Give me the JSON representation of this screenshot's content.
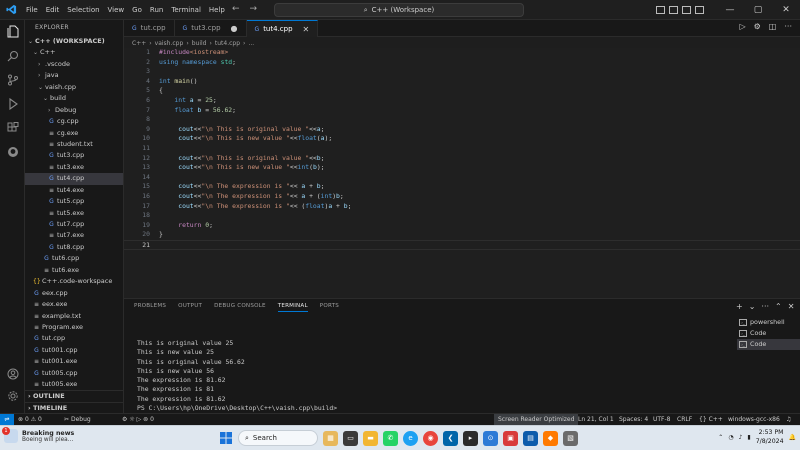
{
  "menu": [
    "File",
    "Edit",
    "Selection",
    "View",
    "Go",
    "Run",
    "Terminal",
    "Help"
  ],
  "command_center": "C++ (Workspace)",
  "sidebar": {
    "title": "EXPLORER",
    "tree": [
      {
        "label": "C++ (WORKSPACE)",
        "depth": 0,
        "kind": "folder-open",
        "bold": true
      },
      {
        "label": "C++",
        "depth": 1,
        "kind": "folder-open"
      },
      {
        "label": ".vscode",
        "depth": 2,
        "kind": "folder"
      },
      {
        "label": "java",
        "depth": 2,
        "kind": "folder"
      },
      {
        "label": "vaish.cpp",
        "depth": 2,
        "kind": "folder-open"
      },
      {
        "label": "build",
        "depth": 3,
        "kind": "folder-open"
      },
      {
        "label": "Debug",
        "depth": 4,
        "kind": "folder"
      },
      {
        "label": "cg.cpp",
        "depth": 4,
        "kind": "cpp"
      },
      {
        "label": "cg.exe",
        "depth": 4,
        "kind": "exe"
      },
      {
        "label": "student.txt",
        "depth": 4,
        "kind": "txt"
      },
      {
        "label": "tut3.cpp",
        "depth": 4,
        "kind": "cpp"
      },
      {
        "label": "tut3.exe",
        "depth": 4,
        "kind": "exe"
      },
      {
        "label": "tut4.cpp",
        "depth": 4,
        "kind": "cpp",
        "active": true
      },
      {
        "label": "tut4.exe",
        "depth": 4,
        "kind": "exe"
      },
      {
        "label": "tut5.cpp",
        "depth": 4,
        "kind": "cpp"
      },
      {
        "label": "tut5.exe",
        "depth": 4,
        "kind": "exe"
      },
      {
        "label": "tut7.cpp",
        "depth": 4,
        "kind": "cpp"
      },
      {
        "label": "tut7.exe",
        "depth": 4,
        "kind": "exe"
      },
      {
        "label": "tut8.cpp",
        "depth": 4,
        "kind": "cpp"
      },
      {
        "label": "tut6.cpp",
        "depth": 3,
        "kind": "cpp"
      },
      {
        "label": "tut6.exe",
        "depth": 3,
        "kind": "exe"
      },
      {
        "label": "C++.code-workspace",
        "depth": 1,
        "kind": "ws"
      },
      {
        "label": "eex.cpp",
        "depth": 1,
        "kind": "cpp"
      },
      {
        "label": "eex.exe",
        "depth": 1,
        "kind": "exe"
      },
      {
        "label": "example.txt",
        "depth": 1,
        "kind": "txt"
      },
      {
        "label": "Program.exe",
        "depth": 1,
        "kind": "exe"
      },
      {
        "label": "tut.cpp",
        "depth": 1,
        "kind": "cpp"
      },
      {
        "label": "tut001.cpp",
        "depth": 1,
        "kind": "cpp"
      },
      {
        "label": "tut001.exe",
        "depth": 1,
        "kind": "exe"
      },
      {
        "label": "tut005.cpp",
        "depth": 1,
        "kind": "cpp"
      },
      {
        "label": "tut005.exe",
        "depth": 1,
        "kind": "exe"
      }
    ],
    "outline": "OUTLINE",
    "timeline": "TIMELINE"
  },
  "tabs": [
    {
      "label": "tut.cpp",
      "state": "normal"
    },
    {
      "label": "tut3.cpp",
      "state": "dirty"
    },
    {
      "label": "tut4.cpp",
      "state": "active"
    }
  ],
  "breadcrumb": [
    "C++",
    "vaish.cpp",
    "build",
    "tut4.cpp",
    "..."
  ],
  "editor": {
    "current_line": 21,
    "lines": [
      "#include<iostream>",
      "using namespace std;",
      "",
      "int main()",
      "{",
      "    int a = 25;",
      "    float b = 56.62;",
      "",
      "     cout<<\"\\n This is original value \"<<a;",
      "     cout<<\"\\n This is new value \"<<float(a);",
      "",
      "     cout<<\"\\n This is original value \"<<b;",
      "     cout<<\"\\n This is new value \"<<int(b);",
      "",
      "     cout<<\"\\n The expression is \"<< a + b;",
      "     cout<<\"\\n The expression is \"<< a + (int)b;",
      "     cout<<\"\\n The expression is \"<< (float)a + b;",
      "",
      "     return 0;",
      "}",
      ""
    ]
  },
  "panel": {
    "tabs": [
      "PROBLEMS",
      "OUTPUT",
      "DEBUG CONSOLE",
      "TERMINAL",
      "PORTS"
    ],
    "active_tab": "TERMINAL",
    "output": [
      "This is original value 25",
      "This is new value 25",
      "This is original value 56.62",
      "This is new value 56",
      "The expression is 81.62",
      "The expression is 81",
      "The expression is 81.62",
      "PS C:\\Users\\hp\\OneDrive\\Desktop\\C++\\vaish.cpp\\build>"
    ],
    "terminals": [
      {
        "label": "powershell",
        "active": false
      },
      {
        "label": "Code",
        "active": false
      },
      {
        "label": "Code",
        "active": true
      }
    ]
  },
  "status": {
    "errors": "0",
    "warnings": "0",
    "debug": "Debug",
    "sync": "0",
    "screen_reader": "Screen Reader Optimized",
    "position": "Ln 21, Col 1",
    "spaces": "Spaces: 4",
    "encoding": "UTF-8",
    "eol": "CRLF",
    "language": "C++",
    "config": "windows-gcc-x86"
  },
  "taskbar": {
    "news_title": "Breaking news",
    "news_sub": "Boeing will plea...",
    "news_badge": "1",
    "search": "Search",
    "time": "2:53 PM",
    "date": "7/8/2024"
  }
}
